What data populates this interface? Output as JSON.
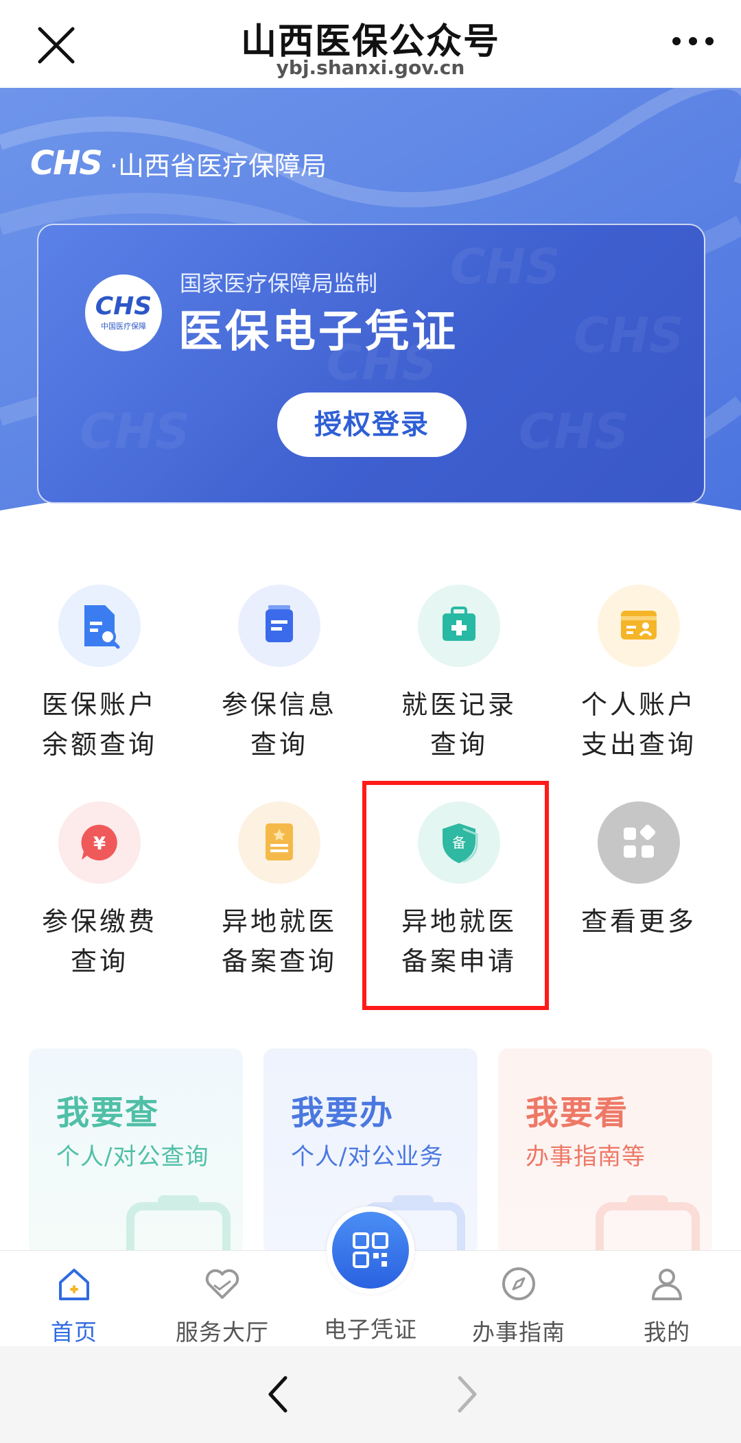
{
  "topbar": {
    "title": "山西医保公众号",
    "url": "ybj.shanxi.gov.cn"
  },
  "banner": {
    "org_mark": "CHS",
    "org_name": "·山西省医疗保障局",
    "card": {
      "supervisor": "国家医疗保障局监制",
      "title": "医保电子凭证",
      "logo_mark": "CHS",
      "logo_sub": "中国医疗保障",
      "auth_button": "授权登录"
    }
  },
  "services": [
    {
      "label": "医保账户\n余额查询",
      "icon": "document-search-icon",
      "color": "#3b7cf0",
      "bg": "#e8f1fd"
    },
    {
      "label": "参保信息\n查询",
      "icon": "info-card-icon",
      "color": "#3b6bea",
      "bg": "#e9effd"
    },
    {
      "label": "就医记录\n查询",
      "icon": "medical-kit-icon",
      "color": "#28b9a4",
      "bg": "#e5f6f3"
    },
    {
      "label": "个人账户\n支出查询",
      "icon": "wallet-user-icon",
      "color": "#f5b528",
      "bg": "#fff4e0"
    },
    {
      "label": "参保缴费\n查询",
      "icon": "yuan-bubble-icon",
      "color": "#f0595a",
      "bg": "#fdeaea"
    },
    {
      "label": "异地就医\n备案查询",
      "icon": "star-notebook-icon",
      "color": "#f5b94a",
      "bg": "#fdf1e1"
    },
    {
      "label": "异地就医\n备案申请",
      "icon": "shield-icon",
      "color": "#2fb8a2",
      "bg": "#e4f6f2",
      "shield_text": "备"
    },
    {
      "label": "查看更多",
      "icon": "grid-more-icon",
      "color": "#ffffff",
      "bg": "#c6c6c6"
    }
  ],
  "features": [
    {
      "title": "我要查",
      "desc": "个人/对公查询",
      "color": "#4fbfa6"
    },
    {
      "title": "我要办",
      "desc": "个人/对公业务",
      "color": "#4a78e0"
    },
    {
      "title": "我要看",
      "desc": "办事指南等",
      "color": "#ee7866"
    }
  ],
  "tabs": [
    {
      "label": "首页",
      "icon": "home-icon",
      "active": true
    },
    {
      "label": "服务大厅",
      "icon": "heart-hands-icon",
      "active": false
    },
    {
      "label": "电子凭证",
      "icon": "qr-code-icon",
      "active": false
    },
    {
      "label": "办事指南",
      "icon": "compass-icon",
      "active": false
    },
    {
      "label": "我的",
      "icon": "user-icon",
      "active": false
    }
  ],
  "colors": {
    "accent": "#2f6be0",
    "highlight": "#ff1a1a",
    "banner": "#5b82e8"
  }
}
